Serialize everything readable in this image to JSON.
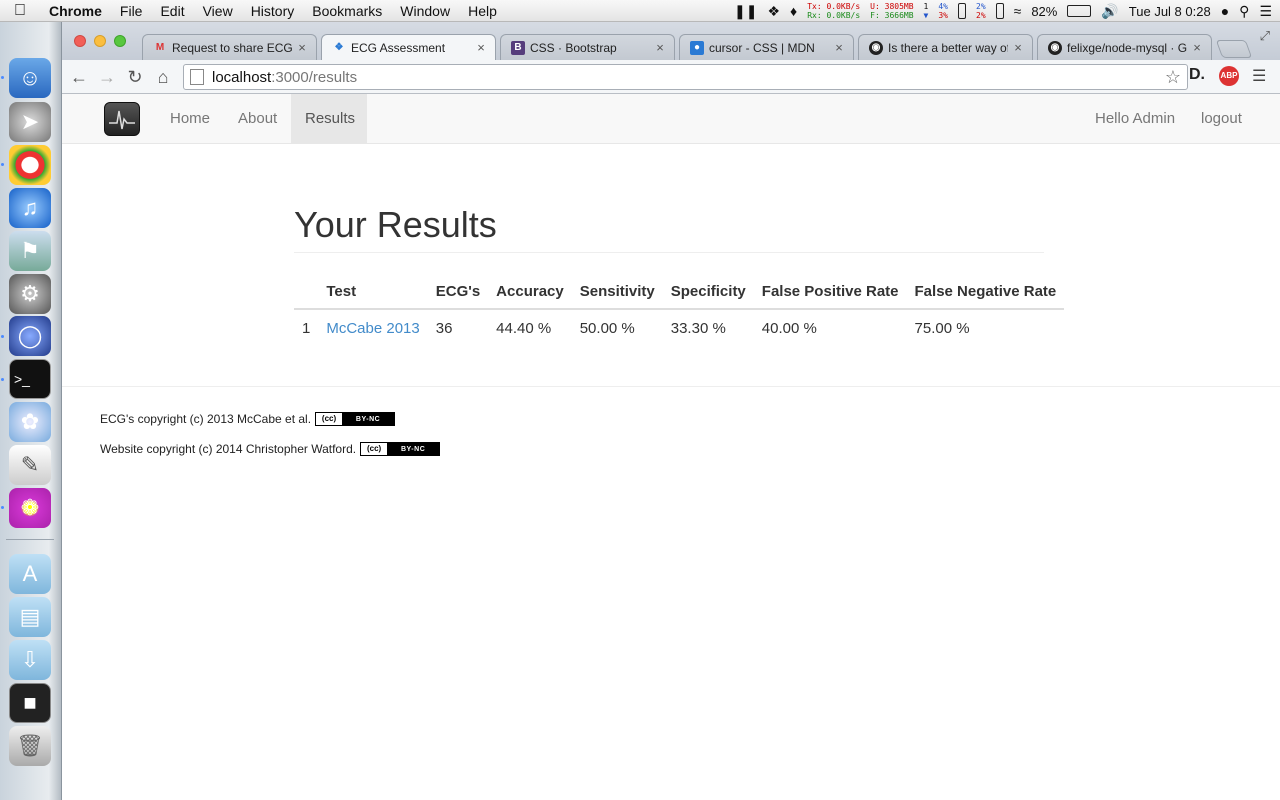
{
  "menubar": {
    "app_name": "Chrome",
    "menus": [
      "File",
      "Edit",
      "View",
      "History",
      "Bookmarks",
      "Window",
      "Help"
    ],
    "net_tx": "Tx:  0.0KB/s",
    "net_rx": "Rx:  0.0KB/s",
    "mem_used": "U: 3805MB",
    "mem_free": "F: 3666MB",
    "cpu_a": "4%",
    "cpu_b": "3%",
    "cpu_c": "2%",
    "cpu_d": "2%",
    "disk_count": "1",
    "battery": "82%",
    "clock": "Tue Jul 8  0:28"
  },
  "browser": {
    "tabs": [
      {
        "label": "Request to share ECG A",
        "favicon": "gmail-icon",
        "active": false
      },
      {
        "label": "ECG Assessment",
        "favicon": "arrows-icon",
        "active": true
      },
      {
        "label": "CSS · Bootstrap",
        "favicon": "bootstrap-icon",
        "active": false
      },
      {
        "label": "cursor - CSS | MDN",
        "favicon": "mdn-icon",
        "active": false
      },
      {
        "label": "Is there a better way of",
        "favicon": "github-icon",
        "active": false
      },
      {
        "label": "felixge/node-mysql · G",
        "favicon": "github-icon",
        "active": false
      }
    ],
    "url_host": "localhost",
    "url_path": ":3000/results",
    "ext_abp": "ABP"
  },
  "site": {
    "nav": {
      "home": "Home",
      "about": "About",
      "results": "Results",
      "greeting": "Hello Admin",
      "logout": "logout"
    },
    "title": "Your Results",
    "table": {
      "headers": [
        "",
        "Test",
        "ECG's",
        "Accuracy",
        "Sensitivity",
        "Specificity",
        "False Positive Rate",
        "False Negative Rate"
      ],
      "rows": [
        {
          "index": "1",
          "test": "McCabe 2013",
          "ecgs": "36",
          "accuracy": "44.40 %",
          "sensitivity": "50.00 %",
          "specificity": "33.30 %",
          "fpr": "40.00 %",
          "fnr": "75.00 %"
        }
      ]
    },
    "footer": {
      "ecg_copyright": "ECG's copyright (c) 2013 McCabe et al.",
      "site_copyright": "Website copyright (c) 2014 Christopher Watford.",
      "cc_mark": "(cc)",
      "license": "BY-NC"
    }
  }
}
